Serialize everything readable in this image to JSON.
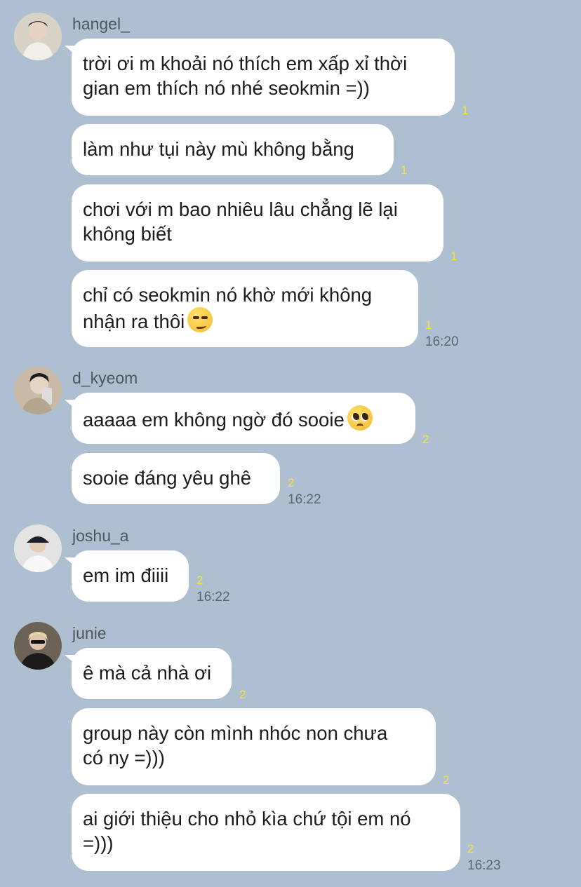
{
  "groups": [
    {
      "sender": "hangel_",
      "avatar_icon": "avatar-hangel-icon",
      "messages": [
        {
          "text": "trời ơi m khoải nó thích em xấp xỉ thời\ngian em thích nó nhé seokmin =))",
          "read": "1"
        },
        {
          "text": "làm như tụi này mù không bằng",
          "read": "1"
        },
        {
          "text": "chơi với m bao nhiêu lâu chẳng lẽ lại\nkhông biết",
          "read": "1"
        },
        {
          "text": "chỉ có seokmin nó khờ mới không\nnhận ra thôi",
          "emoji": "smirking-face-icon",
          "read": "1",
          "time": "16:20"
        }
      ]
    },
    {
      "sender": "d_kyeom",
      "avatar_icon": "avatar-dkyeom-icon",
      "messages": [
        {
          "text": "aaaaa em không ngờ đó sooie",
          "emoji": "pleading-face-icon",
          "read": "2"
        },
        {
          "text": "sooie đáng yêu ghê",
          "read": "2",
          "time": "16:22"
        }
      ]
    },
    {
      "sender": "joshu_a",
      "avatar_icon": "avatar-joshua-icon",
      "messages": [
        {
          "text": "em im điiii",
          "read": "2",
          "time": "16:22"
        }
      ]
    },
    {
      "sender": "junie",
      "avatar_icon": "avatar-junie-icon",
      "messages": [
        {
          "text": "ê mà cả nhà ơi",
          "read": "2"
        },
        {
          "text": "group này còn mình nhóc non chưa\ncó ny =)))",
          "read": "2"
        },
        {
          "text": "ai giới thiệu cho nhỏ kìa chứ tội em nó\n=)))",
          "read": "2",
          "time": "16:23"
        }
      ]
    }
  ],
  "colors": {
    "background": "#aebfd1",
    "bubble": "#ffffff",
    "read_count": "#f5e43a",
    "timestamp": "#5a6773"
  }
}
